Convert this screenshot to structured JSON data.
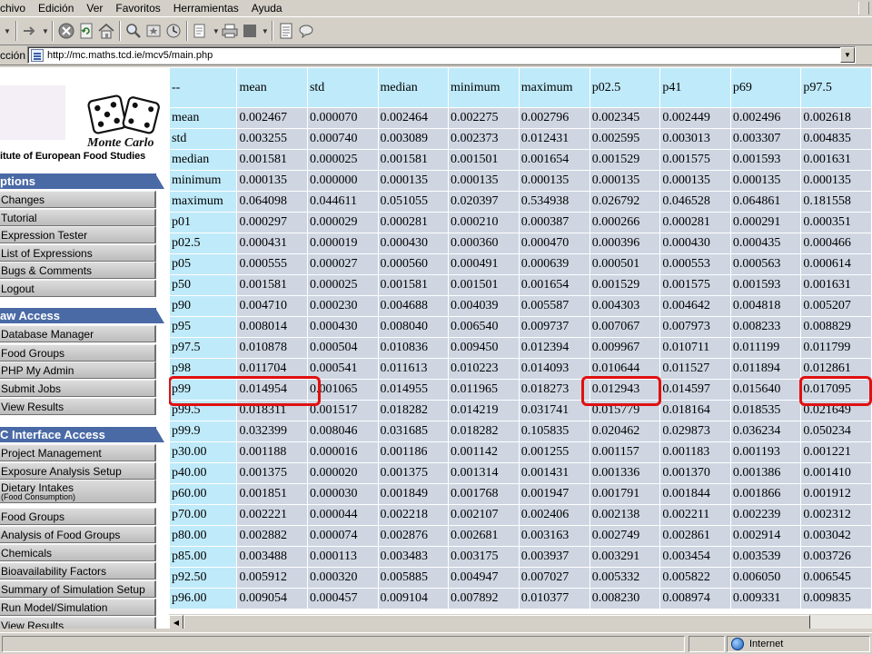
{
  "menu": [
    "chivo",
    "Edición",
    "Ver",
    "Favoritos",
    "Herramientas",
    "Ayuda"
  ],
  "address": {
    "label": "cción",
    "url": "http://mc.maths.tcd.ie/mcv5/main.php"
  },
  "logo": {
    "title": "Monte Carlo",
    "institute": "itute of European Food Studies"
  },
  "sidebar": {
    "sections": [
      {
        "title": "ptions",
        "items": [
          "Changes",
          "Tutorial",
          "Expression Tester",
          "List of Expressions",
          "Bugs & Comments",
          "Logout"
        ]
      },
      {
        "title": "aw Access",
        "items": [
          "Database Manager",
          "Food Groups",
          "PHP My Admin",
          "Submit Jobs",
          "View Results"
        ]
      },
      {
        "title": "C Interface Access",
        "items": [
          "Project Management",
          "Exposure Analysis Setup",
          "Dietary Intakes",
          "Food Groups",
          "Analysis of Food Groups",
          "Chemicals",
          "Bioavailability Factors",
          "Summary of Simulation Setup",
          "Run Model/Simulation",
          "View Results"
        ]
      }
    ],
    "dietary_sub": "(Food Consumption)"
  },
  "table": {
    "headers": [
      "--",
      "mean",
      "std",
      "median",
      "minimum",
      "maximum",
      "p02.5",
      "p41",
      "p69",
      "p97.5"
    ],
    "rows": [
      [
        "mean",
        "0.002467",
        "0.000070",
        "0.002464",
        "0.002275",
        "0.002796",
        "0.002345",
        "0.002449",
        "0.002496",
        "0.002618"
      ],
      [
        "std",
        "0.003255",
        "0.000740",
        "0.003089",
        "0.002373",
        "0.012431",
        "0.002595",
        "0.003013",
        "0.003307",
        "0.004835"
      ],
      [
        "median",
        "0.001581",
        "0.000025",
        "0.001581",
        "0.001501",
        "0.001654",
        "0.001529",
        "0.001575",
        "0.001593",
        "0.001631"
      ],
      [
        "minimum",
        "0.000135",
        "0.000000",
        "0.000135",
        "0.000135",
        "0.000135",
        "0.000135",
        "0.000135",
        "0.000135",
        "0.000135"
      ],
      [
        "maximum",
        "0.064098",
        "0.044611",
        "0.051055",
        "0.020397",
        "0.534938",
        "0.026792",
        "0.046528",
        "0.064861",
        "0.181558"
      ],
      [
        "p01",
        "0.000297",
        "0.000029",
        "0.000281",
        "0.000210",
        "0.000387",
        "0.000266",
        "0.000281",
        "0.000291",
        "0.000351"
      ],
      [
        "p02.5",
        "0.000431",
        "0.000019",
        "0.000430",
        "0.000360",
        "0.000470",
        "0.000396",
        "0.000430",
        "0.000435",
        "0.000466"
      ],
      [
        "p05",
        "0.000555",
        "0.000027",
        "0.000560",
        "0.000491",
        "0.000639",
        "0.000501",
        "0.000553",
        "0.000563",
        "0.000614"
      ],
      [
        "p50",
        "0.001581",
        "0.000025",
        "0.001581",
        "0.001501",
        "0.001654",
        "0.001529",
        "0.001575",
        "0.001593",
        "0.001631"
      ],
      [
        "p90",
        "0.004710",
        "0.000230",
        "0.004688",
        "0.004039",
        "0.005587",
        "0.004303",
        "0.004642",
        "0.004818",
        "0.005207"
      ],
      [
        "p95",
        "0.008014",
        "0.000430",
        "0.008040",
        "0.006540",
        "0.009737",
        "0.007067",
        "0.007973",
        "0.008233",
        "0.008829"
      ],
      [
        "p97.5",
        "0.010878",
        "0.000504",
        "0.010836",
        "0.009450",
        "0.012394",
        "0.009967",
        "0.010711",
        "0.011199",
        "0.011799"
      ],
      [
        "p98",
        "0.011704",
        "0.000541",
        "0.011613",
        "0.010223",
        "0.014093",
        "0.010644",
        "0.011527",
        "0.011894",
        "0.012861"
      ],
      [
        "p99",
        "0.014954",
        "0.001065",
        "0.014955",
        "0.011965",
        "0.018273",
        "0.012943",
        "0.014597",
        "0.015640",
        "0.017095"
      ],
      [
        "p99.5",
        "0.018311",
        "0.001517",
        "0.018282",
        "0.014219",
        "0.031741",
        "0.015779",
        "0.018164",
        "0.018535",
        "0.021649"
      ],
      [
        "p99.9",
        "0.032399",
        "0.008046",
        "0.031685",
        "0.018282",
        "0.105835",
        "0.020462",
        "0.029873",
        "0.036234",
        "0.050234"
      ],
      [
        "p30.00",
        "0.001188",
        "0.000016",
        "0.001186",
        "0.001142",
        "0.001255",
        "0.001157",
        "0.001183",
        "0.001193",
        "0.001221"
      ],
      [
        "p40.00",
        "0.001375",
        "0.000020",
        "0.001375",
        "0.001314",
        "0.001431",
        "0.001336",
        "0.001370",
        "0.001386",
        "0.001410"
      ],
      [
        "p60.00",
        "0.001851",
        "0.000030",
        "0.001849",
        "0.001768",
        "0.001947",
        "0.001791",
        "0.001844",
        "0.001866",
        "0.001912"
      ],
      [
        "p70.00",
        "0.002221",
        "0.000044",
        "0.002218",
        "0.002107",
        "0.002406",
        "0.002138",
        "0.002211",
        "0.002239",
        "0.002312"
      ],
      [
        "p80.00",
        "0.002882",
        "0.000074",
        "0.002876",
        "0.002681",
        "0.003163",
        "0.002749",
        "0.002861",
        "0.002914",
        "0.003042"
      ],
      [
        "p85.00",
        "0.003488",
        "0.000113",
        "0.003483",
        "0.003175",
        "0.003937",
        "0.003291",
        "0.003454",
        "0.003539",
        "0.003726"
      ],
      [
        "p92.50",
        "0.005912",
        "0.000320",
        "0.005885",
        "0.004947",
        "0.007027",
        "0.005332",
        "0.005822",
        "0.006050",
        "0.006545"
      ],
      [
        "p96.00",
        "0.009054",
        "0.000457",
        "0.009104",
        "0.007892",
        "0.010377",
        "0.008230",
        "0.008974",
        "0.009331",
        "0.009835"
      ]
    ]
  },
  "status": {
    "zone": "Internet"
  },
  "colors": {
    "header_bg": "#bfeafa",
    "cell_bg": "#cfd6e2",
    "section_bg": "#4a6aa6",
    "highlight": "#e01010"
  }
}
